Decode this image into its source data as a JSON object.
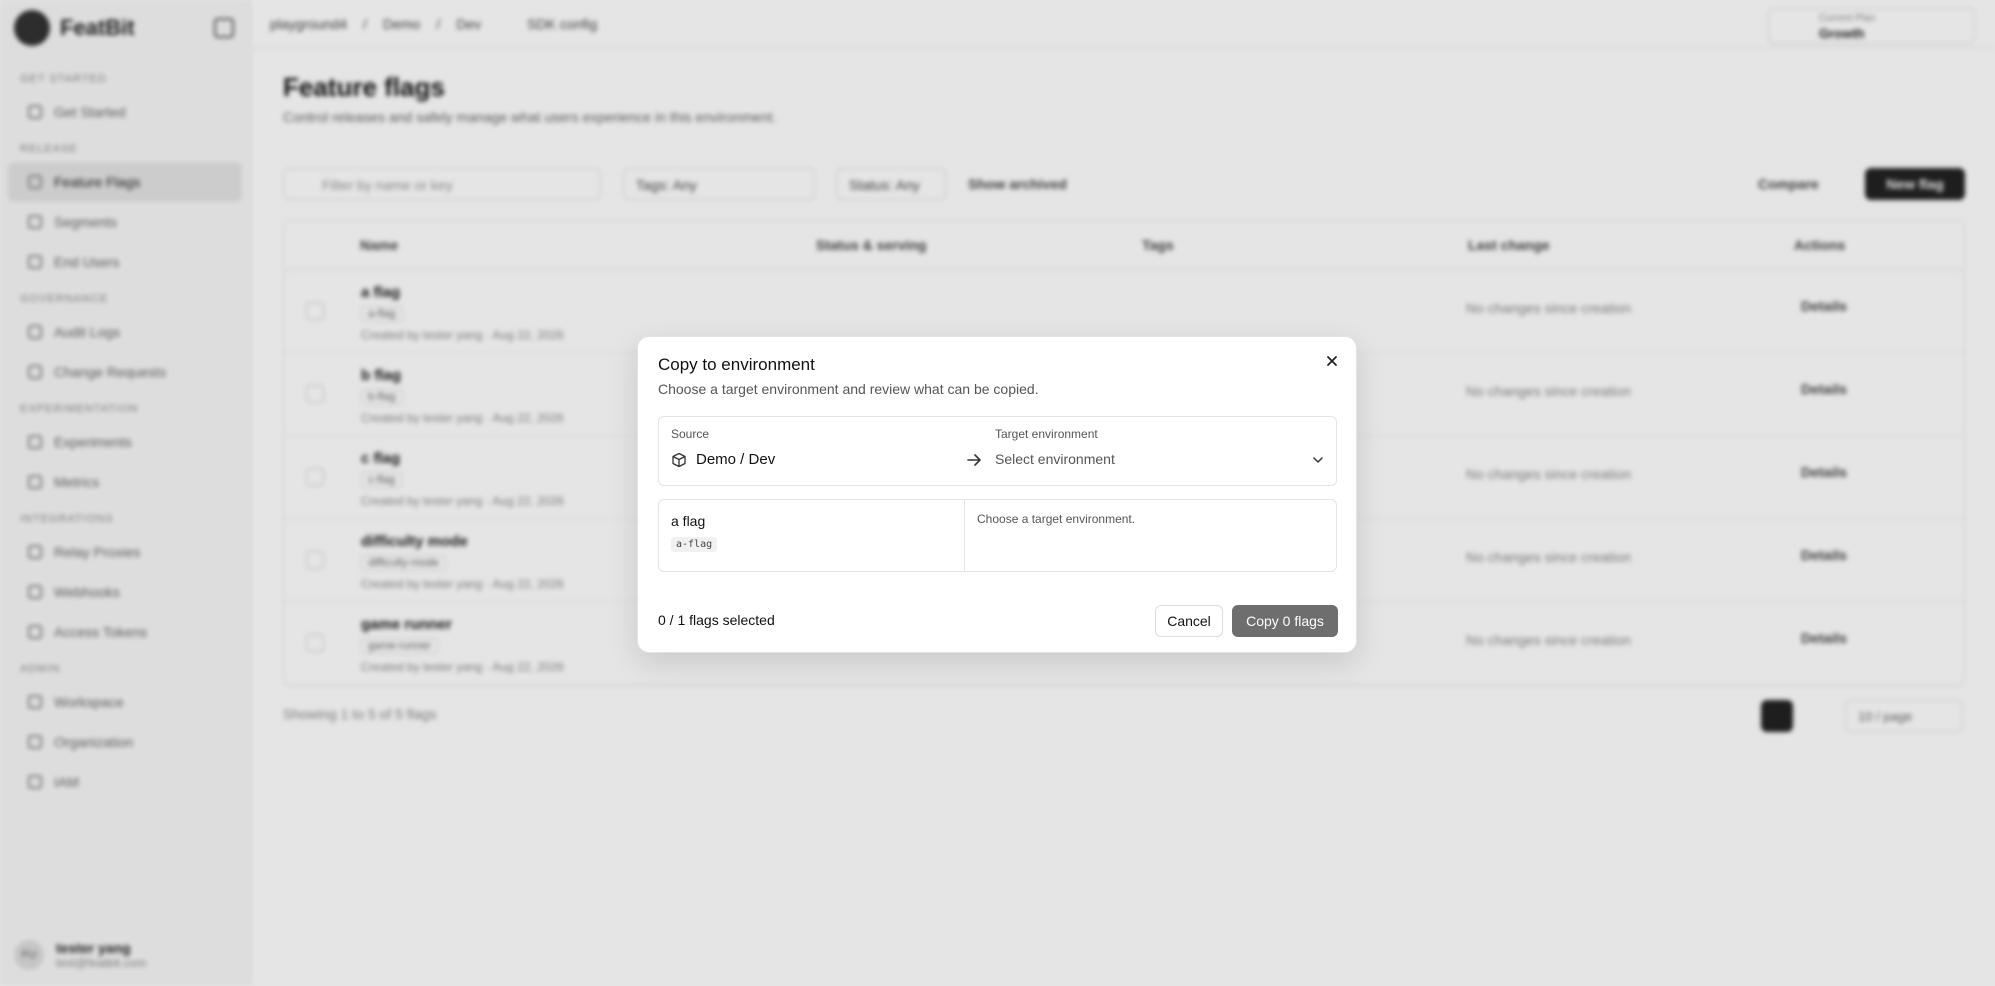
{
  "app": {
    "brand": "FeatBit"
  },
  "topbar": {
    "breadcrumb": [
      "playground4",
      "Demo",
      "Dev"
    ],
    "sdk_config": "SDK config",
    "plan_label": "Current Plan",
    "plan_value": "Growth"
  },
  "sidebar": {
    "groups": [
      {
        "label": "GET STARTED",
        "items": [
          {
            "label": "Get Started",
            "icon": "rocket-icon"
          }
        ]
      },
      {
        "label": "RELEASE",
        "items": [
          {
            "label": "Feature Flags",
            "icon": "flag-icon",
            "active": true
          },
          {
            "label": "Segments",
            "icon": "segments-icon"
          },
          {
            "label": "End Users",
            "icon": "users-icon"
          }
        ]
      },
      {
        "label": "GOVERNANCE",
        "items": [
          {
            "label": "Audit Logs",
            "icon": "history-icon"
          },
          {
            "label": "Change Requests",
            "icon": "request-icon"
          }
        ]
      },
      {
        "label": "EXPERIMENTATION",
        "items": [
          {
            "label": "Experiments",
            "icon": "flask-icon"
          },
          {
            "label": "Metrics",
            "icon": "metrics-icon"
          }
        ]
      },
      {
        "label": "INTEGRATIONS",
        "items": [
          {
            "label": "Relay Proxies",
            "icon": "relay-icon"
          },
          {
            "label": "Webhooks",
            "icon": "webhook-icon"
          },
          {
            "label": "Access Tokens",
            "icon": "key-icon"
          }
        ]
      },
      {
        "label": "ADMIN",
        "items": [
          {
            "label": "Workspace",
            "icon": "workspace-icon"
          },
          {
            "label": "Organization",
            "icon": "building-icon"
          },
          {
            "label": "IAM",
            "icon": "shield-icon"
          }
        ]
      }
    ],
    "user": {
      "initials": "FU",
      "name": "tester yang",
      "email": "test@featbit.com"
    }
  },
  "page": {
    "title": "Feature flags",
    "subtitle": "Control releases and safely manage what users experience in this environment.",
    "search_placeholder": "Filter by name or key",
    "tags_filter": "Tags: Any",
    "status_filter": "Status: Any",
    "show_archived": "Show archived",
    "compare": "Compare",
    "new_flag": "New flag",
    "columns": [
      "Name",
      "Status & serving",
      "Tags",
      "Last change",
      "Actions"
    ],
    "rows": [
      {
        "name": "a flag",
        "key": "a-flag",
        "meta": "Created by tester yang · Aug 22, 2026",
        "last_change": "No changes since creation",
        "action": "Details"
      },
      {
        "name": "b flag",
        "key": "b-flag",
        "meta": "Created by tester yang · Aug 22, 2026",
        "last_change": "No changes since creation",
        "action": "Details"
      },
      {
        "name": "c flag",
        "key": "c-flag",
        "meta": "Created by tester yang · Aug 22, 2026",
        "last_change": "No changes since creation",
        "action": "Details"
      },
      {
        "name": "difficulty mode",
        "key": "difficulty-mode",
        "meta": "Created by tester yang · Aug 22, 2026",
        "last_change": "No changes since creation",
        "action": "Details"
      },
      {
        "name": "game runner",
        "key": "game-runner",
        "meta": "Created by tester yang · Aug 22, 2026",
        "last_change": "No changes since creation",
        "action": "Details"
      }
    ],
    "footer": "Showing 1 to 5 of 5 flags",
    "per_page": "10 / page"
  },
  "modal": {
    "title": "Copy to environment",
    "description": "Choose a target environment and review what can be copied.",
    "source_label": "Source",
    "source_value": "Demo / Dev",
    "target_label": "Target environment",
    "target_placeholder": "Select environment",
    "flag_name": "a flag",
    "flag_key": "a-flag",
    "hint": "Choose a target environment.",
    "selected_count": "0 / 1 flags selected",
    "cancel": "Cancel",
    "copy": "Copy 0 flags"
  }
}
